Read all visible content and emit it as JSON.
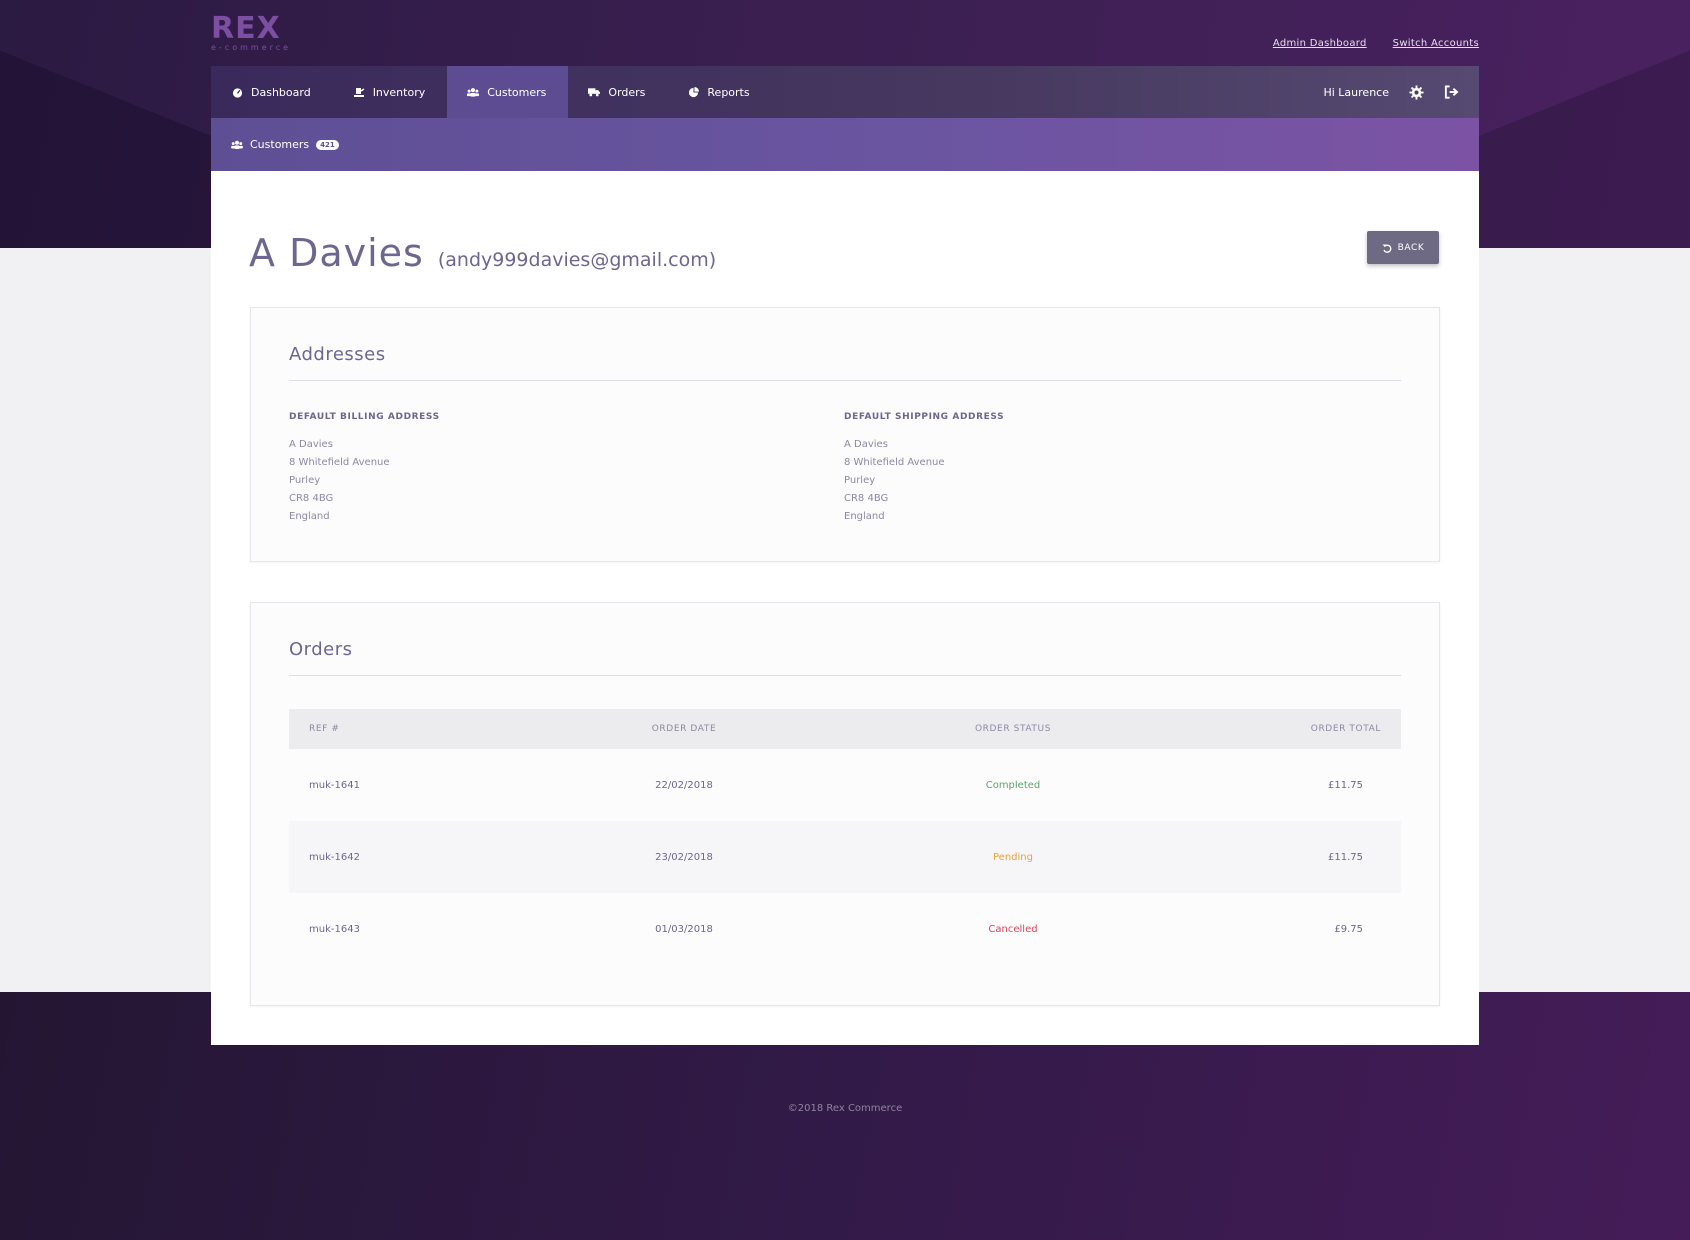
{
  "brand": {
    "name": "REX",
    "tagline": "e-commerce"
  },
  "top_links": {
    "admin": "Admin Dashboard",
    "switch": "Switch Accounts"
  },
  "nav": {
    "items": [
      {
        "label": "Dashboard",
        "icon": "dashboard-icon"
      },
      {
        "label": "Inventory",
        "icon": "inventory-icon"
      },
      {
        "label": "Customers",
        "icon": "customers-icon"
      },
      {
        "label": "Orders",
        "icon": "truck-icon"
      },
      {
        "label": "Reports",
        "icon": "pie-chart-icon"
      }
    ],
    "active": "Customers",
    "greeting": "Hi Laurence"
  },
  "subnav": {
    "label": "Customers",
    "count": "421"
  },
  "customer": {
    "name": "A Davies",
    "email": "(andy999davies@gmail.com)"
  },
  "back_label": "BACK",
  "addresses": {
    "title": "Addresses",
    "billing": {
      "heading": "DEFAULT BILLING ADDRESS",
      "lines": [
        "A Davies",
        "8 Whitefield Avenue",
        "Purley",
        "CR8 4BG",
        "England"
      ]
    },
    "shipping": {
      "heading": "DEFAULT SHIPPING ADDRESS",
      "lines": [
        "A Davies",
        "8 Whitefield Avenue",
        "Purley",
        "CR8 4BG",
        "England"
      ]
    }
  },
  "orders": {
    "title": "Orders",
    "columns": [
      "REF #",
      "ORDER DATE",
      "ORDER STATUS",
      "ORDER TOTAL"
    ],
    "rows": [
      {
        "ref": "muk-1641",
        "date": "22/02/2018",
        "status": "Completed",
        "total": "£11.75"
      },
      {
        "ref": "muk-1642",
        "date": "23/02/2018",
        "status": "Pending",
        "total": "£11.75"
      },
      {
        "ref": "muk-1643",
        "date": "01/03/2018",
        "status": "Cancelled",
        "total": "£9.75"
      }
    ]
  },
  "colors": {
    "completed": "#5ea66a",
    "pending": "#f0a232",
    "cancelled": "#e0435a",
    "accent": "#5d4c92"
  },
  "footer": "©2018 Rex Commerce"
}
